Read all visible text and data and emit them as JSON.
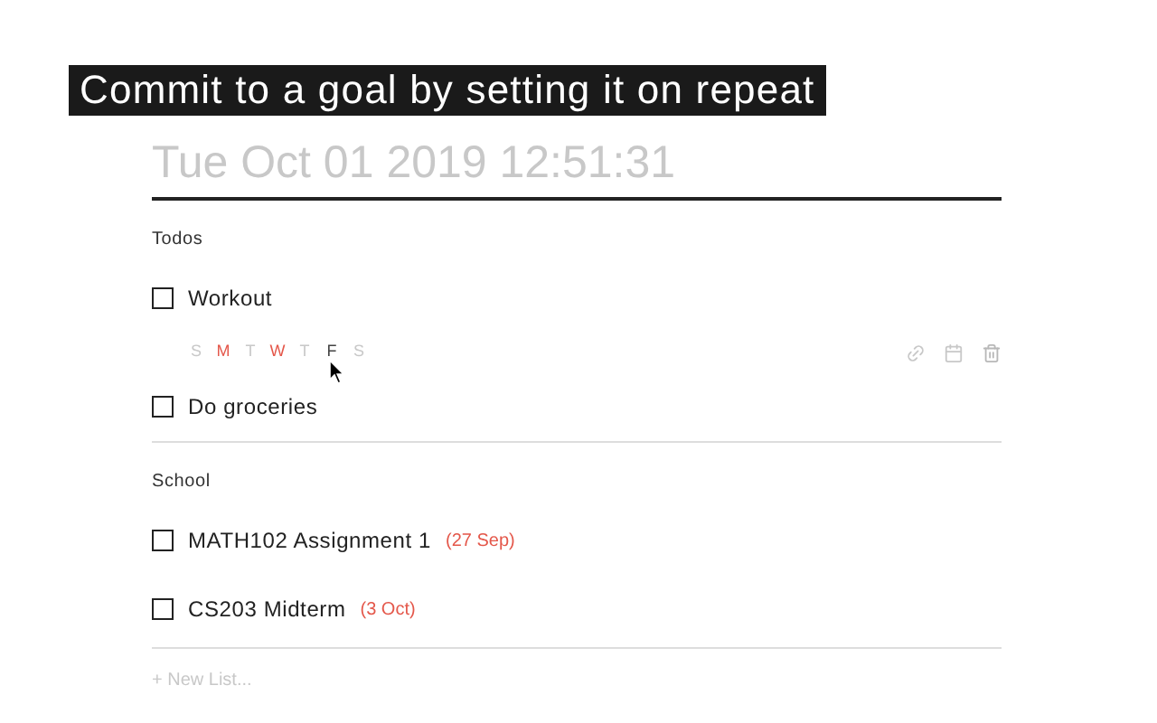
{
  "caption": "Commit to a goal by setting it on repeat",
  "title_field": {
    "placeholder": "Tue Oct 01 2019 12:51:31"
  },
  "lists": [
    {
      "name": "Todos",
      "items": [
        {
          "label": "Workout",
          "checked": false,
          "days": [
            {
              "letter": "S",
              "selected": false,
              "hovered": false
            },
            {
              "letter": "M",
              "selected": true,
              "hovered": false
            },
            {
              "letter": "T",
              "selected": false,
              "hovered": false
            },
            {
              "letter": "W",
              "selected": true,
              "hovered": false
            },
            {
              "letter": "T",
              "selected": false,
              "hovered": false
            },
            {
              "letter": "F",
              "selected": false,
              "hovered": true
            },
            {
              "letter": "S",
              "selected": false,
              "hovered": false
            }
          ]
        },
        {
          "label": "Do groceries",
          "checked": false
        }
      ]
    },
    {
      "name": "School",
      "items": [
        {
          "label": "MATH102 Assignment 1",
          "due": "(27 Sep)",
          "checked": false
        },
        {
          "label": "CS203 Midterm",
          "due": "(3 Oct)",
          "checked": false
        }
      ]
    }
  ],
  "new_list": "+ New List..."
}
